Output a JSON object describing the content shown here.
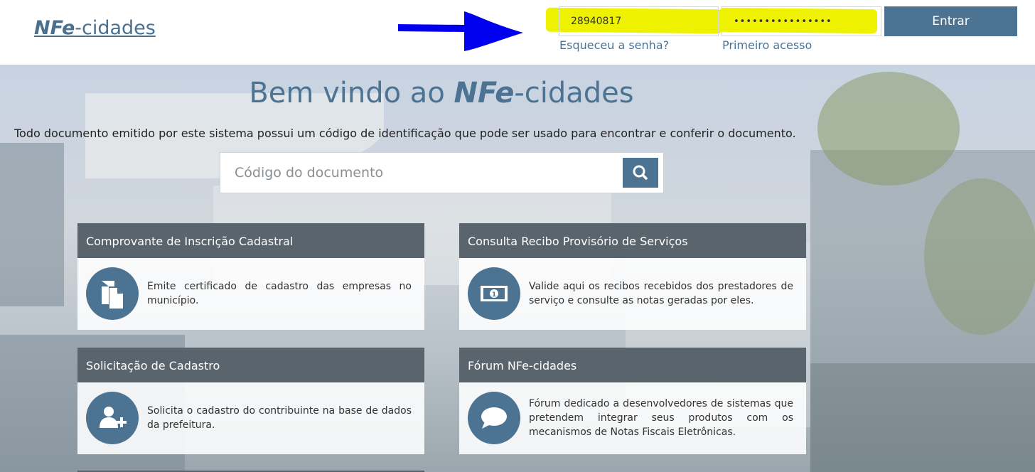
{
  "header": {
    "logo_bold": "NFe",
    "logo_rest": "-cidades",
    "username_value": "28940817",
    "password_value": "••••••••••••••••",
    "login_button": "Entrar",
    "forgot_link": "Esqueceu a senha?",
    "first_access_link": "Primeiro acesso"
  },
  "main": {
    "welcome_prefix": "Bem vindo ao ",
    "welcome_bold": "NFe",
    "welcome_suffix": "-cidades",
    "subtitle": "Todo documento emitido por este sistema possui um código de identificação que pode ser usado para encontrar e conferir o documento.",
    "search_placeholder": "Código do documento"
  },
  "cards": [
    {
      "title": "Comprovante de Inscrição Cadastral",
      "text": "Emite certificado de cadastro das empresas no município.",
      "icon": "document-copy-icon"
    },
    {
      "title": "Consulta Recibo Provisório de Serviços",
      "text": "Valide aqui os recibos recebidos dos prestadores de serviço e consulte as notas geradas por eles.",
      "icon": "money-bill-icon"
    },
    {
      "title": "Solicitação de Cadastro",
      "text": "Solicita o cadastro do contribuinte na base de dados da prefeitura.",
      "icon": "add-user-icon"
    },
    {
      "title": "Fórum NFe-cidades",
      "text": "Fórum dedicado a desenvolvedores de sistemas que pretendem integrar seus produtos com os mecanismos de Notas Fiscais Eletrônicas.",
      "icon": "speech-bubble-icon"
    }
  ],
  "colors": {
    "accent": "#4d7393",
    "card_header": "#5a646c",
    "highlight": "#eef200",
    "annotation_arrow": "#0000ee"
  }
}
